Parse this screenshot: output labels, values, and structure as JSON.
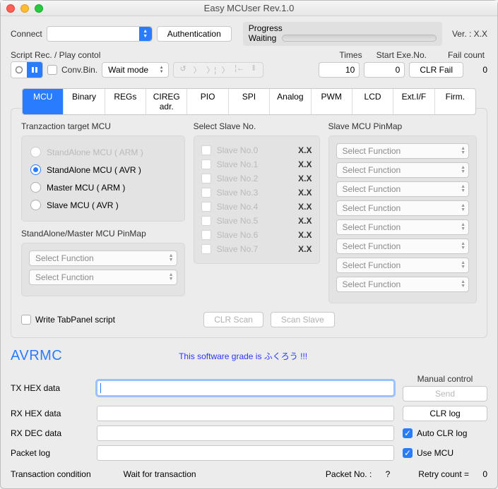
{
  "window": {
    "title": "Easy MCUser Rev.1.0"
  },
  "row1": {
    "connect_label": "Connect",
    "auth_button": "Authentication",
    "progress_label": "Progress",
    "progress_status": "Waiting",
    "version": "Ver. : X.X"
  },
  "row2": {
    "script_label": "Script Rec. / Play contol",
    "times_label": "Times",
    "startexe_label": "Start Exe.No.",
    "failcount_label": "Fail count",
    "convbin_label": "Conv.Bin.",
    "mode_value": "Wait mode",
    "times_value": "10",
    "startexe_value": "0",
    "clrfail_button": "CLR Fail",
    "fail_value": "0"
  },
  "tabs": [
    "MCU",
    "Binary",
    "REGs",
    "CIREG adr.",
    "PIO",
    "SPI",
    "Analog",
    "PWM",
    "LCD",
    "Ext.I/F",
    "Firm."
  ],
  "active_tab": "MCU",
  "mcu": {
    "target_header": "Tranzaction target MCU",
    "radios": [
      {
        "label": "StandAlone MCU ( ARM )",
        "disabled": true,
        "selected": false
      },
      {
        "label": "StandAlone MCU ( AVR )",
        "disabled": false,
        "selected": true
      },
      {
        "label": "Master MCU ( ARM )",
        "disabled": false,
        "selected": false
      },
      {
        "label": "Slave MCU ( AVR )",
        "disabled": false,
        "selected": false
      }
    ],
    "pinmap_header": "StandAlone/Master MCU PinMap",
    "pinmap_select": "Select Function",
    "slave_header": "Select Slave No.",
    "slaves": [
      {
        "label": "Slave No.0",
        "value": "X.X"
      },
      {
        "label": "Slave No.1",
        "value": "X.X"
      },
      {
        "label": "Slave No.2",
        "value": "X.X"
      },
      {
        "label": "Slave No.3",
        "value": "X.X"
      },
      {
        "label": "Slave No.4",
        "value": "X.X"
      },
      {
        "label": "Slave No.5",
        "value": "X.X"
      },
      {
        "label": "Slave No.6",
        "value": "X.X"
      },
      {
        "label": "Slave No.7",
        "value": "X.X"
      }
    ],
    "slave_pinmap_header": "Slave MCU PinMap",
    "write_tab_label": "Write TabPanel script",
    "clr_scan": "CLR Scan",
    "scan_slave": "Scan Slave"
  },
  "brand": {
    "name": "AVRMC",
    "tagline": "This software grade is ふくろう !!!"
  },
  "data": {
    "tx_label": "TX HEX data",
    "rx_label": "RX HEX data",
    "rxdec_label": "RX DEC data",
    "packet_label": "Packet log",
    "manual_header": "Manual control",
    "send_btn": "Send",
    "clrlog_btn": "CLR log",
    "autoclr_label": "Auto CLR log",
    "usemcu_label": "Use MCU"
  },
  "footer": {
    "cond_label": "Transaction condition",
    "cond_value": "Wait for transaction",
    "packet_label": "Packet No. :",
    "packet_value": "?",
    "retry_label": "Retry count  =",
    "retry_value": "0"
  }
}
